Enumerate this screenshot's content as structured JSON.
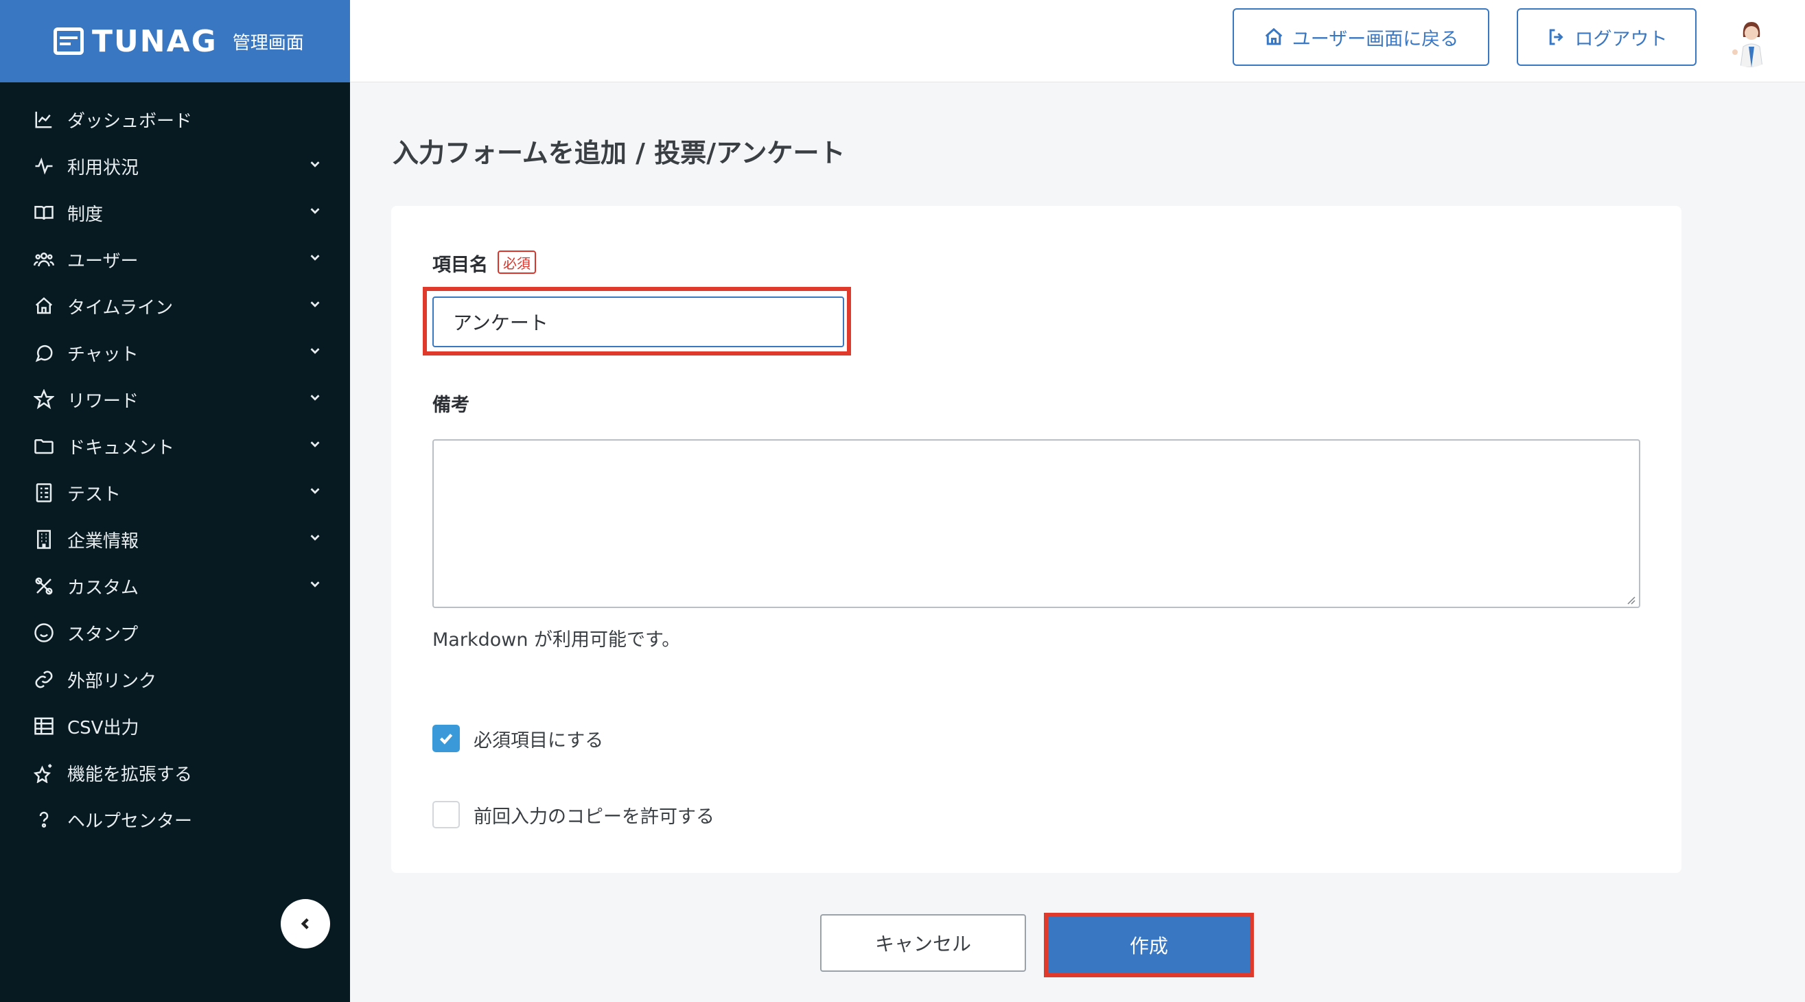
{
  "brand": {
    "name": "TUNAG",
    "subtitle": "管理画面"
  },
  "sidebar": {
    "items": [
      {
        "label": "ダッシュボード",
        "icon": "chart-line-icon",
        "expandable": false
      },
      {
        "label": "利用状況",
        "icon": "activity-icon",
        "expandable": true
      },
      {
        "label": "制度",
        "icon": "book-open-icon",
        "expandable": true
      },
      {
        "label": "ユーザー",
        "icon": "users-icon",
        "expandable": true
      },
      {
        "label": "タイムライン",
        "icon": "home-icon",
        "expandable": true
      },
      {
        "label": "チャット",
        "icon": "chat-bubble-icon",
        "expandable": true
      },
      {
        "label": "リワード",
        "icon": "star-icon",
        "expandable": true
      },
      {
        "label": "ドキュメント",
        "icon": "folder-icon",
        "expandable": true
      },
      {
        "label": "テスト",
        "icon": "checklist-icon",
        "expandable": true
      },
      {
        "label": "企業情報",
        "icon": "building-icon",
        "expandable": true
      },
      {
        "label": "カスタム",
        "icon": "tools-icon",
        "expandable": true
      },
      {
        "label": "スタンプ",
        "icon": "smile-icon",
        "expandable": false
      },
      {
        "label": "外部リンク",
        "icon": "link-icon",
        "expandable": false
      },
      {
        "label": "CSV出力",
        "icon": "table-icon",
        "expandable": false
      },
      {
        "label": "機能を拡張する",
        "icon": "sparkle-star-icon",
        "expandable": false
      },
      {
        "label": "ヘルプセンター",
        "icon": "help-icon",
        "expandable": false
      }
    ]
  },
  "header": {
    "user_screen_label": "ユーザー画面に戻る",
    "logout_label": "ログアウト"
  },
  "page": {
    "title": "入力フォームを追加 / 投票/アンケート"
  },
  "form": {
    "name_label": "項目名",
    "required_badge": "必須",
    "name_value": "アンケート",
    "notes_label": "備考",
    "notes_value": "",
    "markdown_hint": "Markdown が利用可能です。",
    "required_checkbox_label": "必須項目にする",
    "required_checked": true,
    "copy_checkbox_label": "前回入力のコピーを許可する",
    "copy_checked": false
  },
  "actions": {
    "cancel_label": "キャンセル",
    "create_label": "作成"
  },
  "colors": {
    "brand_blue": "#3a77c2",
    "sidebar_bg": "#071a22",
    "highlight_red": "#e03a2c",
    "checkbox_blue": "#3a9ad9"
  }
}
